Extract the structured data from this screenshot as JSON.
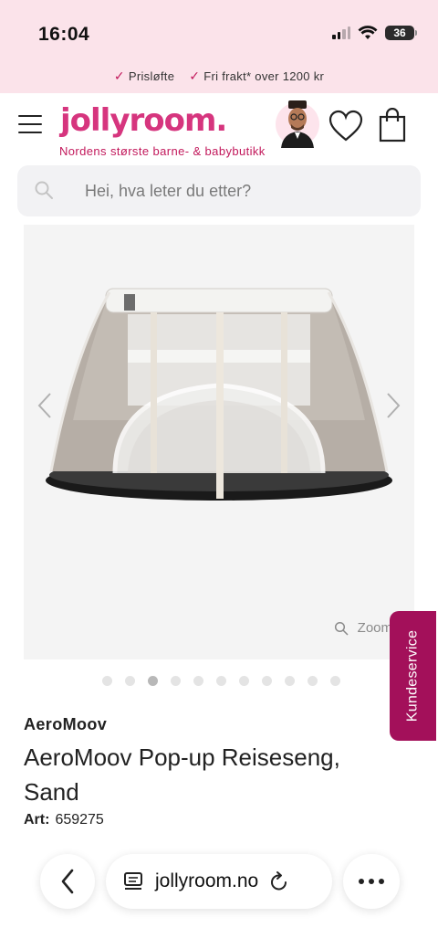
{
  "status_bar": {
    "time": "16:04",
    "battery": "36"
  },
  "promo": {
    "items": [
      "Prisløfte",
      "Fri frakt* over 1200 kr"
    ]
  },
  "header": {
    "logo": "jollyroom.",
    "tagline": "Nordens største barne- & babybutikk"
  },
  "search": {
    "placeholder": "Hei, hva leter du etter?"
  },
  "gallery": {
    "zoom_label": "Zoom",
    "image_count": 11,
    "active_index": 2
  },
  "kundeservice": {
    "label": "Kundeservice"
  },
  "product": {
    "brand": "AeroMoov",
    "title": "AeroMoov Pop-up Reiseseng, Sand",
    "art_label": "Art:",
    "art_number": "659275"
  },
  "browser": {
    "url": "jollyroom.no"
  },
  "colors": {
    "brand_pink": "#d6357e",
    "accent_magenta": "#a3105a",
    "promo_bg": "#fbe3ea"
  },
  "icons": [
    "signal-icon",
    "wifi-icon",
    "battery-icon",
    "check-icon",
    "menu-icon",
    "avatar",
    "heart-icon",
    "bag-icon",
    "search-icon",
    "chevron-left-icon",
    "chevron-right-icon",
    "zoom-icon",
    "back-icon",
    "tabs-icon",
    "reload-icon",
    "more-icon"
  ]
}
